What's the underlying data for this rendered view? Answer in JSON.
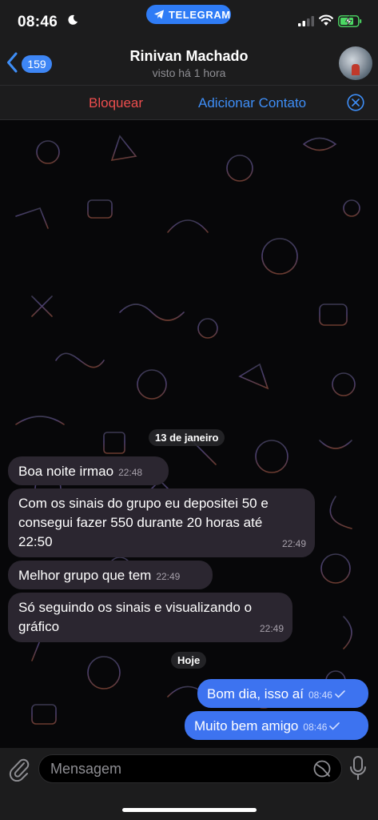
{
  "status_bar": {
    "time": "08:46",
    "app_pill": "TELEGRAM",
    "icons": [
      "moon-icon",
      "telegram-icon",
      "signal-icon",
      "wifi-icon",
      "battery-charging-icon"
    ],
    "colors": {
      "pill": "#2f7cf6",
      "battery": "#4cd964"
    }
  },
  "header": {
    "back_count": "159",
    "title": "Rinivan Machado",
    "subtitle": "visto há 1 hora"
  },
  "actions": {
    "block": "Bloquear",
    "add_contact": "Adicionar Contato",
    "colors": {
      "block": "#eb4d4d",
      "add": "#3e8ef7"
    }
  },
  "chat": {
    "date1": "13 de janeiro",
    "date2": "Hoje",
    "messages": [
      {
        "text": "Boa noite irmao",
        "time": "22:48",
        "direction": "in"
      },
      {
        "line1": "Com os sinais do grupo eu depositei 50 e",
        "line2": "consegui fazer 550 durante 20 horas até",
        "line3": "22:50",
        "time": "22:49",
        "direction": "in"
      },
      {
        "text": "Melhor grupo que tem",
        "time": "22:49",
        "direction": "in"
      },
      {
        "line1": "Só seguindo os sinais e visualizando o",
        "line2": "gráfico",
        "time": "22:49",
        "direction": "in"
      },
      {
        "text": "Bom dia, isso aí",
        "time": "08:46",
        "direction": "out",
        "status": "read"
      },
      {
        "text": "Muito bem amigo",
        "time": "08:46",
        "direction": "out",
        "status": "read"
      }
    ],
    "colors": {
      "incoming": "#2b2630",
      "outgoing": "#3d73f0"
    }
  },
  "composer": {
    "placeholder": "Mensagem",
    "icons": [
      "attach-icon",
      "sticker-icon",
      "mic-icon"
    ]
  }
}
